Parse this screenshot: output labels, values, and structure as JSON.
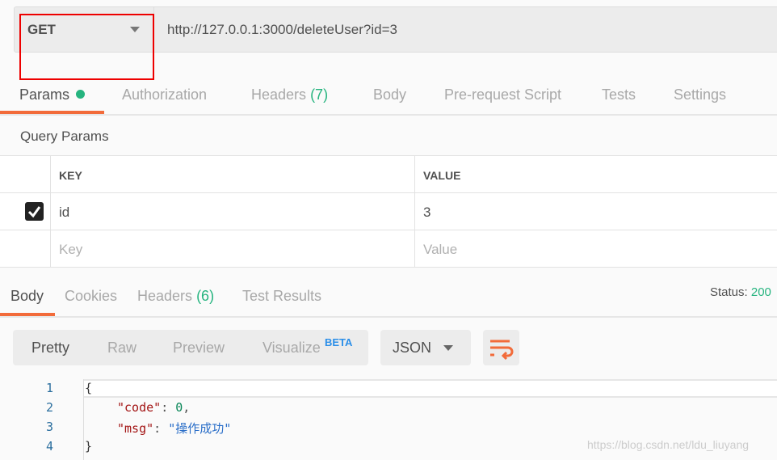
{
  "request": {
    "method": "GET",
    "url": "http://127.0.0.1:3000/deleteUser?id=3"
  },
  "request_tabs": [
    {
      "label": "Params"
    },
    {
      "label": "Authorization"
    },
    {
      "label": "Headers",
      "count": "(7)"
    },
    {
      "label": "Body"
    },
    {
      "label": "Pre-request Script"
    },
    {
      "label": "Tests"
    },
    {
      "label": "Settings"
    }
  ],
  "query_params": {
    "title": "Query Params",
    "headers": [
      "KEY",
      "VALUE"
    ],
    "rows": [
      {
        "checked": true,
        "key": "id",
        "value": "3"
      }
    ],
    "placeholder": {
      "key": "Key",
      "value": "Value"
    }
  },
  "response_tabs": [
    {
      "label": "Body"
    },
    {
      "label": "Cookies"
    },
    {
      "label": "Headers",
      "count": "(6)"
    },
    {
      "label": "Test Results"
    }
  ],
  "status": {
    "label": "Status:",
    "value": "200"
  },
  "view_modes": [
    "Pretty",
    "Raw",
    "Preview",
    "Visualize"
  ],
  "beta": "BETA",
  "format": "JSON",
  "code": {
    "line_numbers": [
      "1",
      "2",
      "3",
      "4"
    ],
    "open": "{",
    "k1": "\"code\"",
    "v1": "0",
    "k2": "\"msg\"",
    "v2": "\"操作成功\"",
    "close": "}"
  },
  "watermark": "https://blog.csdn.net/ldu_liuyang",
  "colors": {
    "accent": "#f26b3a",
    "green": "#26b47f",
    "highlight": "#e00000"
  }
}
